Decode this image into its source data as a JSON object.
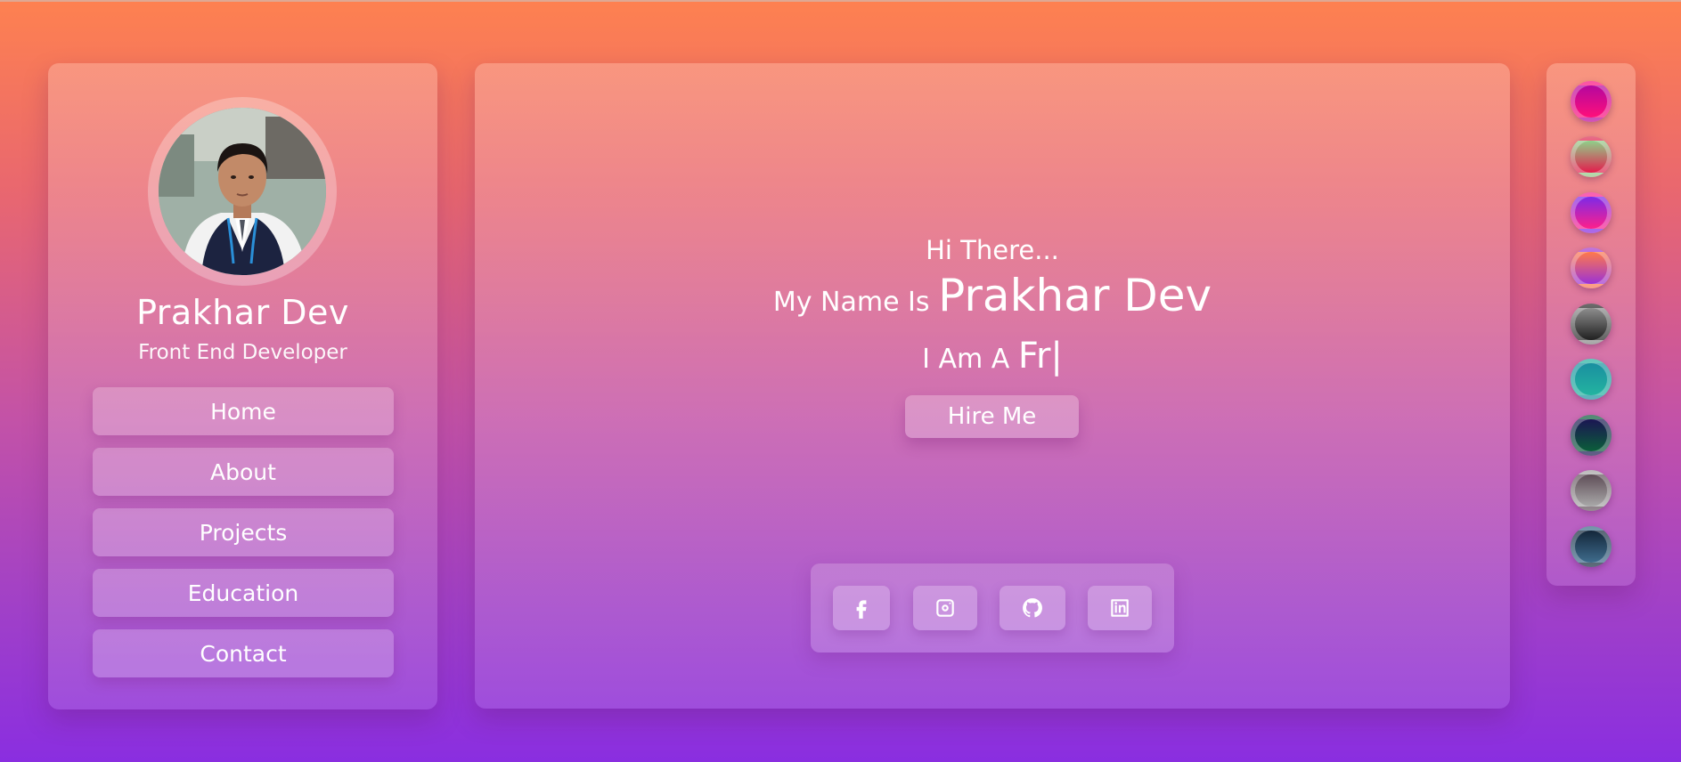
{
  "profile": {
    "name": "Prakhar Dev",
    "role": "Front End Developer"
  },
  "nav": {
    "items": [
      {
        "label": "Home"
      },
      {
        "label": "About"
      },
      {
        "label": "Projects"
      },
      {
        "label": "Education"
      },
      {
        "label": "Contact"
      }
    ]
  },
  "hero": {
    "greeting": "Hi There...",
    "name_prefix": "My Name Is",
    "name": "Prakhar Dev",
    "iam_prefix": "I Am A",
    "typed_text": "Fr|",
    "hire_label": "Hire Me"
  },
  "social": [
    "facebook-icon",
    "instagram-icon",
    "github-icon",
    "linkedin-icon"
  ],
  "themes": [
    {
      "name": "magenta",
      "top": "#b4079e",
      "bottom": "#ff0f7b"
    },
    {
      "name": "green-red",
      "top": "#8fd18a",
      "bottom": "#e41c4c"
    },
    {
      "name": "purple-pink",
      "top": "#7c2ae8",
      "bottom": "#ff1f8a"
    },
    {
      "name": "orange-purple",
      "top": "#ff7a4a",
      "bottom": "#9b32d6"
    },
    {
      "name": "gray-black",
      "top": "#8e8e8e",
      "bottom": "#202020"
    },
    {
      "name": "teal",
      "top": "#1a8fa0",
      "bottom": "#23b3a0"
    },
    {
      "name": "dark-green",
      "top": "#1b1553",
      "bottom": "#0b5e3a"
    },
    {
      "name": "gray-mauve",
      "top": "#5f4d57",
      "bottom": "#a9a9a9"
    },
    {
      "name": "navy-steel",
      "top": "#13263a",
      "bottom": "#3f6d8d"
    }
  ]
}
